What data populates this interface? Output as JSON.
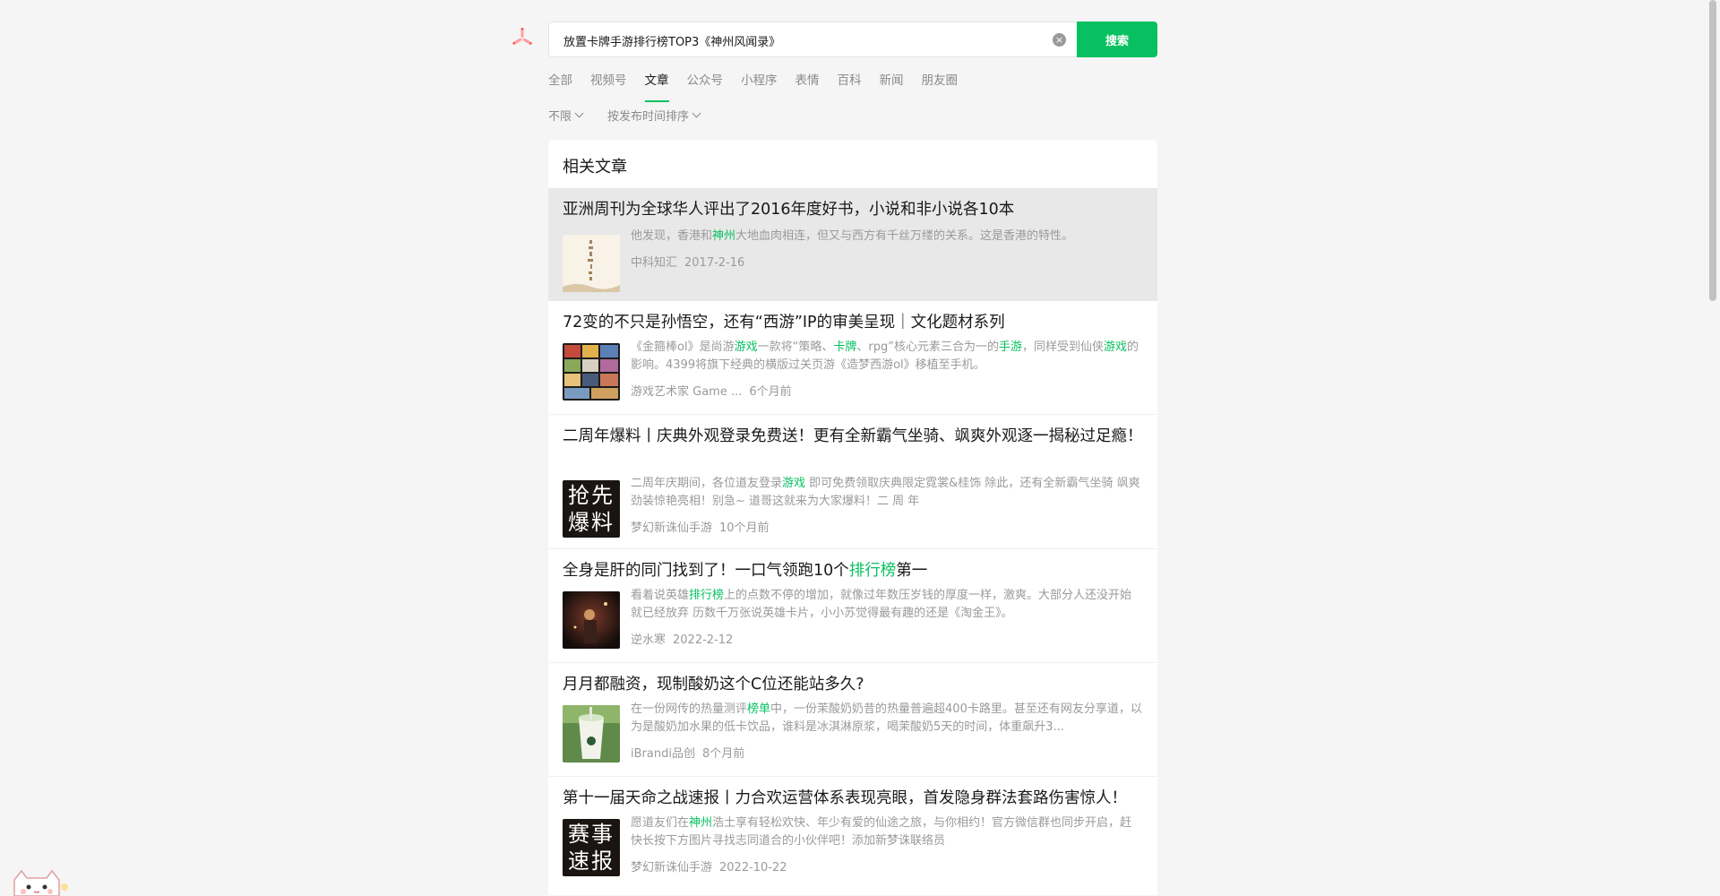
{
  "search": {
    "query": "放置卡牌手游排行榜TOP3《神州风闻录》",
    "button_label": "搜索"
  },
  "tabs": [
    {
      "label": "全部",
      "active": false
    },
    {
      "label": "视频号",
      "active": false
    },
    {
      "label": "文章",
      "active": true
    },
    {
      "label": "公众号",
      "active": false
    },
    {
      "label": "小程序",
      "active": false
    },
    {
      "label": "表情",
      "active": false
    },
    {
      "label": "百科",
      "active": false
    },
    {
      "label": "新闻",
      "active": false
    },
    {
      "label": "朋友圈",
      "active": false
    }
  ],
  "filters": [
    {
      "label": "不限"
    },
    {
      "label": "按发布时间排序"
    }
  ],
  "section_title": "相关文章",
  "colors": {
    "accent": "#07c160",
    "highlight": "#07c160"
  },
  "results": [
    {
      "title": [
        {
          "t": "亚洲周刊为全球华人评出了2016年度好书，小说和非小说各10本"
        }
      ],
      "snippet": [
        {
          "t": "他发现，香港和"
        },
        {
          "t": "神州",
          "hl": true
        },
        {
          "t": "大地血肉相连，但又与西方有千丝万缕的关系。这是香港的特性。"
        }
      ],
      "source": "中科知汇",
      "time": "2017-2-16",
      "thumb": "book-cover-thumbnail"
    },
    {
      "title": [
        {
          "t": "72变的不只是孙悟空，还有“西游”IP的审美呈现｜文化题材系列"
        }
      ],
      "snippet": [
        {
          "t": "《金箍棒ol》是尚游"
        },
        {
          "t": "游戏",
          "hl": true
        },
        {
          "t": "一款将“策略、"
        },
        {
          "t": "卡牌",
          "hl": true
        },
        {
          "t": "、rpg”核心元素三合为一的"
        },
        {
          "t": "手游",
          "hl": true
        },
        {
          "t": "，同样受到仙侠"
        },
        {
          "t": "游戏",
          "hl": true
        },
        {
          "t": "的影响。4399将旗下经典的横版过关页游《造梦西游ol》移植至手机。"
        }
      ],
      "source": "游戏艺术家 Game ...",
      "time": "6个月前",
      "thumb": "game-collage-thumbnail"
    },
    {
      "title": [
        {
          "t": "二周年爆料丨庆典外观登录免费送！更有全新霸气坐骑、飒爽外观逐一揭秘过足瘾！"
        }
      ],
      "snippet": [
        {
          "t": "二周年庆期间，各位道友登录"
        },
        {
          "t": "游戏",
          "hl": true
        },
        {
          "t": " 即可免费领取庆典限定霓裳&桂饰 除此，还有全新霸气坐骑 飒爽劲装惊艳亮相！别急~ 道哥这就来为大家爆料！二 周 年"
        }
      ],
      "source": "梦幻新诛仙手游",
      "time": "10个月前",
      "thumb": "calligraphy-thumbnail",
      "thumb_text": [
        "抢先",
        "爆料"
      ]
    },
    {
      "title": [
        {
          "t": "全身是肝的同门找到了！一口气领跑10个"
        },
        {
          "t": "排行榜",
          "hl": true
        },
        {
          "t": "第一"
        }
      ],
      "snippet": [
        {
          "t": "看着说英雄"
        },
        {
          "t": "排行榜",
          "hl": true
        },
        {
          "t": "上的点数不停的增加，就像过年数压岁钱的厚度一样，激爽。大部分人还没开始就已经放弃 历数千万张说英雄卡片，小小苏觉得最有趣的还是《淘金王》。"
        }
      ],
      "source": "逆水寒",
      "time": "2022-2-12",
      "thumb": "dark-scene-thumbnail"
    },
    {
      "title": [
        {
          "t": "月月都融资，现制酸奶这个C位还能站多久?"
        }
      ],
      "snippet": [
        {
          "t": "在一份网传的热量测评"
        },
        {
          "t": "榜单",
          "hl": true
        },
        {
          "t": "中，一份茉酸奶奶昔的热量普遍超400卡路里。甚至还有网友分享道，以为是酸奶加水果的低卡饮品，谁料是冰淇淋原浆，喝茉酸奶5天的时间，体重飙升3..."
        }
      ],
      "source": "iBrandi品创",
      "time": "8个月前",
      "thumb": "yogurt-cup-thumbnail"
    },
    {
      "title": [
        {
          "t": "第十一届天命之战速报丨力合欢运营体系表现亮眼，首发隐身群法套路伤害惊人！"
        }
      ],
      "snippet": [
        {
          "t": "愿道友们在"
        },
        {
          "t": "神州",
          "hl": true
        },
        {
          "t": "浩土享有轻松欢快、年少有爱的仙途之旅，与你相约！官方微信群也同步开启，赶快长按下方图片寻找志同道合的小伙伴吧！添加新梦诛联络员"
        }
      ],
      "source": "梦幻新诛仙手游",
      "time": "2022-10-22",
      "thumb": "calligraphy-thumbnail",
      "thumb_text": [
        "赛事",
        "速报"
      ]
    }
  ]
}
